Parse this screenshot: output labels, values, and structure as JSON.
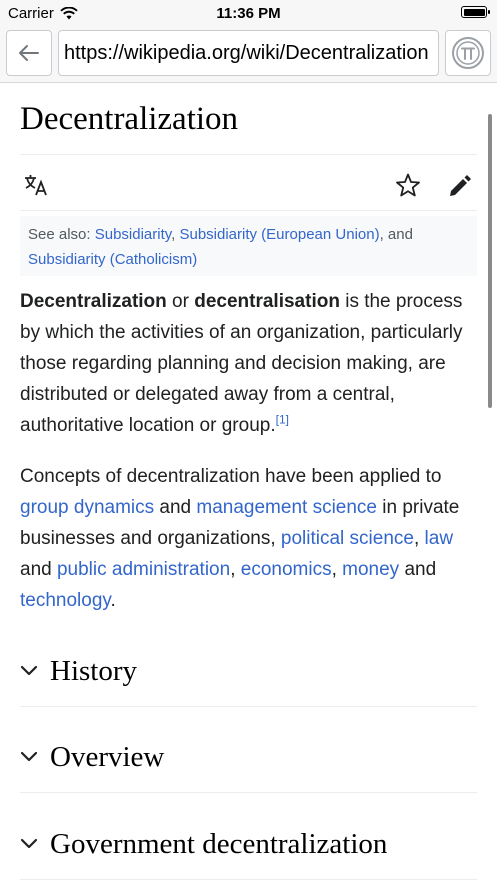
{
  "status_bar": {
    "carrier": "Carrier",
    "time": "11:36 PM"
  },
  "toolbar": {
    "url": "https://wikipedia.org/wiki/Decentralization"
  },
  "article": {
    "title": "Decentralization",
    "hatnote": {
      "prefix": "See also: ",
      "links": [
        "Subsidiarity",
        "Subsidiarity (European Union)",
        "Subsidiarity (Catholicism)"
      ],
      "sep1": ", ",
      "sep2": ", and"
    },
    "p1": {
      "bold1": "Decentralization",
      "t1": " or ",
      "bold2": "decentralisation",
      "t2": " is the process by which the activities of an organization, particularly those regarding planning and decision making, are distributed or delegated away from a central, authoritative location or group.",
      "ref": "[1]"
    },
    "p2": {
      "t0": "Concepts of decentralization have been applied to ",
      "l1": "group dynamics",
      "t1": " and ",
      "l2": "management science",
      "t2": " in private businesses and organizations, ",
      "l3": "political science",
      "t3": ", ",
      "l4": "law",
      "t4": " and ",
      "l5": "public administration",
      "t5": ", ",
      "l6": "economics",
      "t6": ", ",
      "l7": "money",
      "t7": " and ",
      "l8": "technology",
      "t8": "."
    },
    "sections": [
      "History",
      "Overview",
      "Government decentralization"
    ]
  },
  "icons": [
    "back-arrow-icon",
    "pi-icon",
    "translate-icon",
    "star-icon",
    "pencil-icon",
    "chevron-down-icon",
    "wifi-icon",
    "battery-icon"
  ]
}
